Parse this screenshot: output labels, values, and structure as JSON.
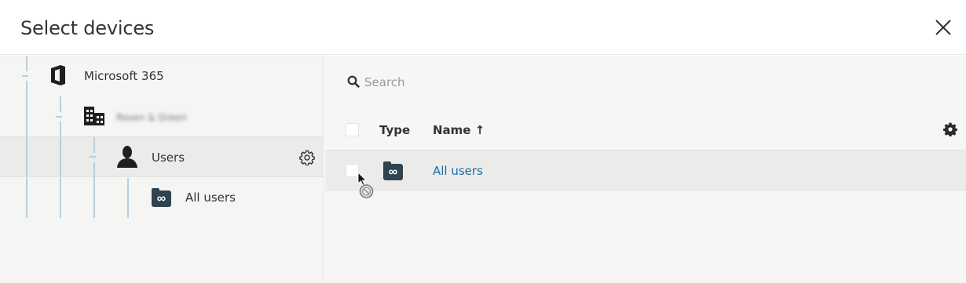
{
  "dialog": {
    "title": "Select devices",
    "close_icon": "close-icon"
  },
  "tree": {
    "items": [
      {
        "label": "Microsoft 365",
        "icon": "office-365-icon"
      },
      {
        "label": "Rosen & Green",
        "icon": "building-icon",
        "blurred": true
      },
      {
        "label": "Users",
        "icon": "user-icon",
        "selected": true,
        "action_icon": "gear-icon"
      },
      {
        "label": "All users",
        "icon": "all-users-group-icon"
      }
    ]
  },
  "main": {
    "search": {
      "placeholder": "Search",
      "value": ""
    },
    "columns": {
      "type": "Type",
      "name": "Name ↑"
    },
    "settings_icon": "gear-icon",
    "rows": [
      {
        "type_icon": "all-users-group-icon",
        "name": "All users"
      }
    ]
  },
  "colors": {
    "accent_link": "#1a6fa8",
    "tree_line": "#b7cfdf",
    "icon_dark": "#2f4350"
  }
}
